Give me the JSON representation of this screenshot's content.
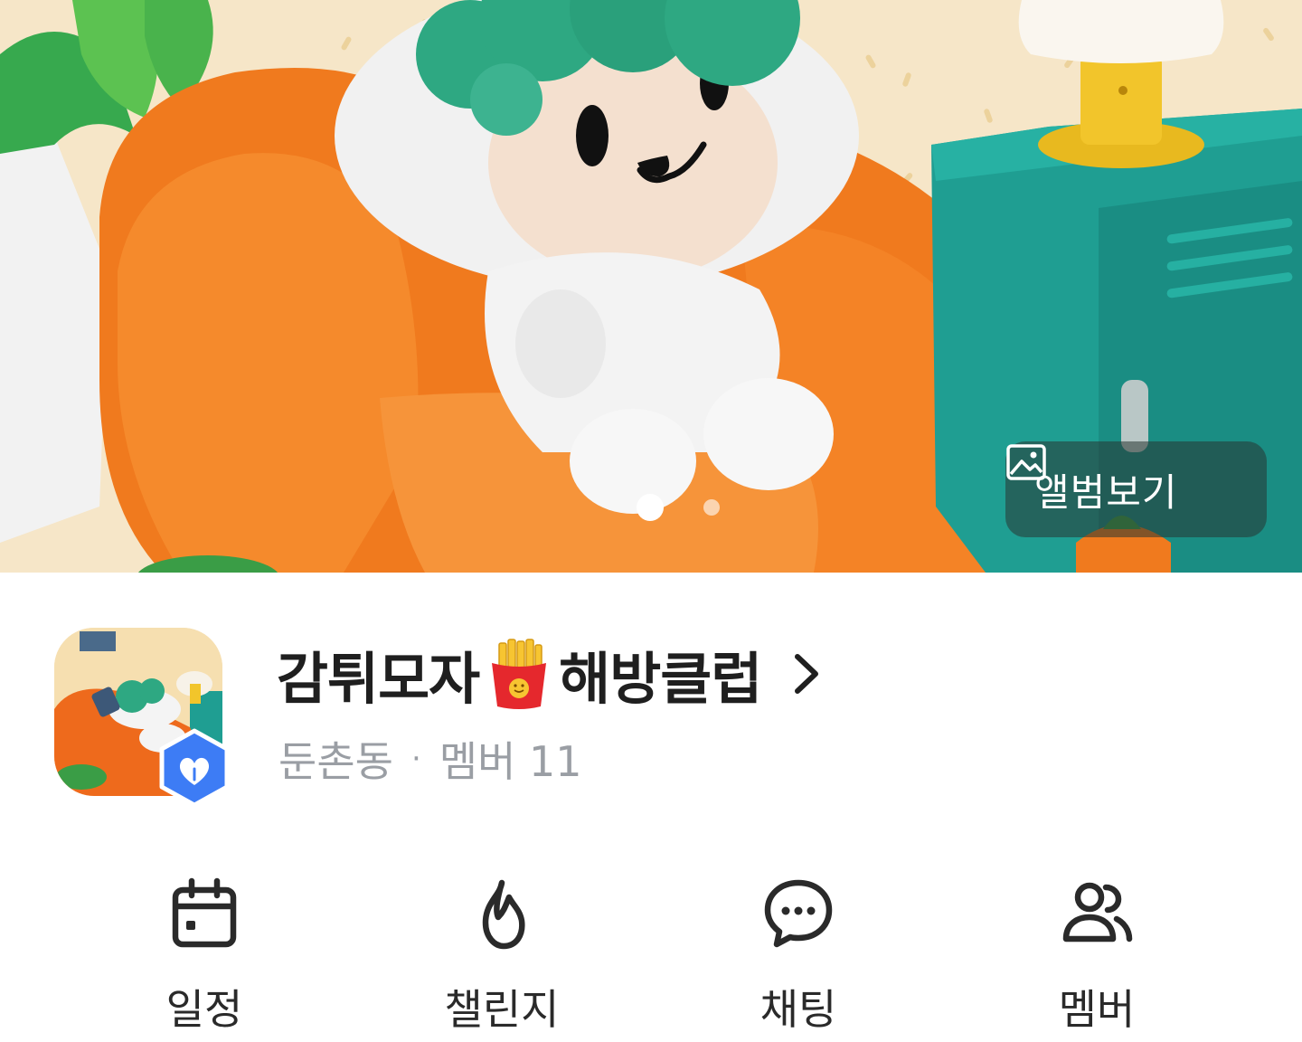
{
  "hero": {
    "album_label": "앨범보기",
    "page_indicator": {
      "current": 1,
      "total": 2
    }
  },
  "club": {
    "name_part1": "감튀모자",
    "name_part2": "해방클럽",
    "location": "둔촌동",
    "separator": "·",
    "members_text": "멤버 11"
  },
  "actions": [
    {
      "label": "일정",
      "icon": "calendar-icon"
    },
    {
      "label": "챌린지",
      "icon": "flame-icon"
    },
    {
      "label": "채팅",
      "icon": "chat-bubble-icon"
    },
    {
      "label": "멤버",
      "icon": "members-icon"
    }
  ],
  "colors": {
    "title": "#1f1f1f",
    "meta": "#9a9ea4",
    "badge_blue": "#3d7cf5",
    "chair_orange": "#f07a1e",
    "cabinet_teal": "#1f9e92"
  }
}
